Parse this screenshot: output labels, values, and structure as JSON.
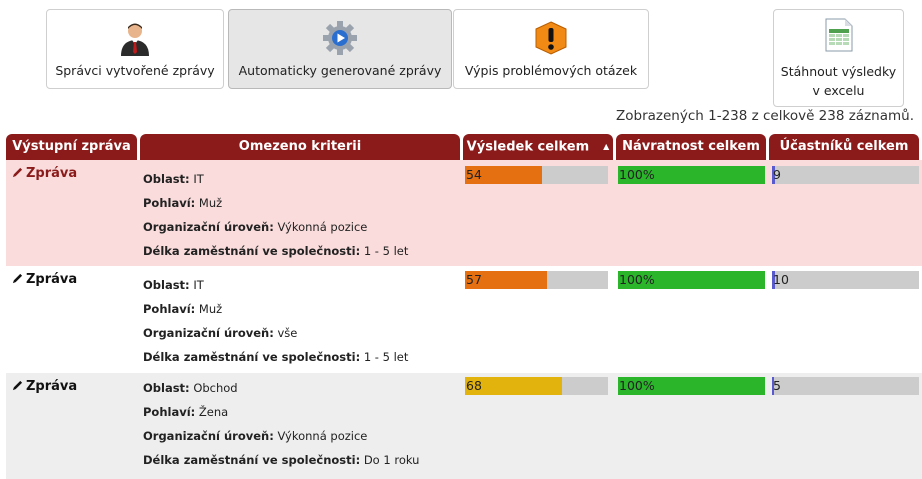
{
  "toolbar": {
    "buttons": [
      {
        "label": "Správci vytvořené zprávy",
        "icon": "manager-person-icon",
        "active": false
      },
      {
        "label": "Automaticky generované zprávy",
        "icon": "gear-play-icon",
        "active": true
      },
      {
        "label": "Výpis problémových otázek",
        "icon": "warning-icon",
        "active": false
      }
    ],
    "excel": {
      "line1": "Stáhnout výsledky",
      "line2": "v excelu",
      "icon": "excel-spreadsheet-icon"
    }
  },
  "summary": "Zobrazených 1-238 z celkově 238 záznamů.",
  "table": {
    "headers": [
      "Výstupní zpráva",
      "Omezeno kriterii",
      "Výsledek celkem",
      "Návratnost celkem",
      "Účastníků celkem"
    ],
    "rows": [
      {
        "report_label": "Zpráva",
        "criteria": [
          {
            "key": "Oblast:",
            "value": "IT"
          },
          {
            "key": "Pohlaví:",
            "value": "Muž"
          },
          {
            "key": "Organizační úroveň:",
            "value": "Výkonná pozice"
          },
          {
            "key": "Délka zaměstnání ve společnosti:",
            "value": "1 - 5 let"
          }
        ],
        "result": {
          "label": "54",
          "fraction": 0.54,
          "color": "#e57012"
        },
        "return": {
          "label": "100%",
          "fraction": 1.0,
          "color": "#2ab52a"
        },
        "participants": {
          "label": "9",
          "fraction": 0.02,
          "color": "#5a5acf"
        }
      },
      {
        "report_label": "Zpráva",
        "criteria": [
          {
            "key": "Oblast:",
            "value": "IT"
          },
          {
            "key": "Pohlaví:",
            "value": "Muž"
          },
          {
            "key": "Organizační úroveň:",
            "value": "vše"
          },
          {
            "key": "Délka zaměstnání ve společnosti:",
            "value": "1 - 5 let"
          }
        ],
        "result": {
          "label": "57",
          "fraction": 0.57,
          "color": "#e57012"
        },
        "return": {
          "label": "100%",
          "fraction": 1.0,
          "color": "#2ab52a"
        },
        "participants": {
          "label": "10",
          "fraction": 0.02,
          "color": "#5a5acf"
        }
      },
      {
        "report_label": "Zpráva",
        "criteria": [
          {
            "key": "Oblast:",
            "value": "Obchod"
          },
          {
            "key": "Pohlaví:",
            "value": "Žena"
          },
          {
            "key": "Organizační úroveň:",
            "value": "Výkonná pozice"
          },
          {
            "key": "Délka zaměstnání ve společnosti:",
            "value": "Do 1 roku"
          }
        ],
        "result": {
          "label": "68",
          "fraction": 0.68,
          "color": "#e2b20d"
        },
        "return": {
          "label": "100%",
          "fraction": 1.0,
          "color": "#2ab52a"
        },
        "participants": {
          "label": "5",
          "fraction": 0.01,
          "color": "#5a5acf"
        }
      }
    ],
    "row_backgrounds": [
      "#fadcdc",
      "#ffffff",
      "#eeeeee"
    ],
    "header_color": "#8b1b1b"
  }
}
